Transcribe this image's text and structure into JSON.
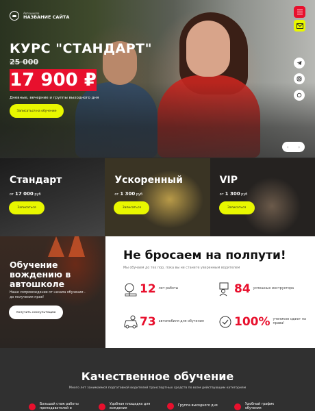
{
  "brand": {
    "small": "Автошкола",
    "name": "НАЗВАНИЕ САЙТА"
  },
  "hero": {
    "title": "КУРС \"СТАНДАРТ\"",
    "old_price": "25 000",
    "new_price": "17 900 ₽",
    "subtitle": "Дневные, вечерние и группы выходного дня",
    "cta": "Записаться на обучение"
  },
  "courses": [
    {
      "title": "Стандарт",
      "price_prefix": "от",
      "price": "17 000",
      "currency": "руб",
      "button": "Записаться"
    },
    {
      "title": "Ускоренный",
      "price_prefix": "от",
      "price": "1 300",
      "currency": "руб",
      "button": "Записаться"
    },
    {
      "title": "VIP",
      "price_prefix": "от",
      "price": "1 300",
      "currency": "руб",
      "button": "Записаться"
    }
  ],
  "training": {
    "title_line1": "Обучение",
    "title_line2": "вождению в",
    "title_line3": "автошколе",
    "subtitle": "Наше сопровождение от начала обучения - до получения прав!",
    "button": "получить консультацию"
  },
  "stats": {
    "title": "Не бросаем на полпути!",
    "subtitle": "Мы обучаем до тех пор, пока вы не станете уверенным водителем",
    "items": [
      {
        "number": "12",
        "label": "лет работы",
        "icon": "road-sign-icon"
      },
      {
        "number": "84",
        "label": "успешных инструктора",
        "icon": "instructor-icon"
      },
      {
        "number": "73",
        "label": "автомобиля для обучения",
        "icon": "car-icon"
      },
      {
        "number": "100%",
        "label_line1": "учеников сдают на",
        "label_line2": "права!",
        "icon": "license-icon"
      }
    ]
  },
  "quality": {
    "title": "Качественное обучение",
    "subtitle": "Много лет занимаемся подготовкой водителей транспортных средств по всем действующим категориям",
    "features": [
      {
        "line1": "Большой стаж работы",
        "line2": "преподавателей и"
      },
      {
        "line1": "Удобная площадка для",
        "line2": "вождения"
      },
      {
        "line1": "Группа выходного дня",
        "line2": ""
      },
      {
        "line1": "Удобный график",
        "line2": "обучения"
      }
    ]
  },
  "colors": {
    "accent_red": "#e8102d",
    "accent_yellow": "#e8f700"
  }
}
